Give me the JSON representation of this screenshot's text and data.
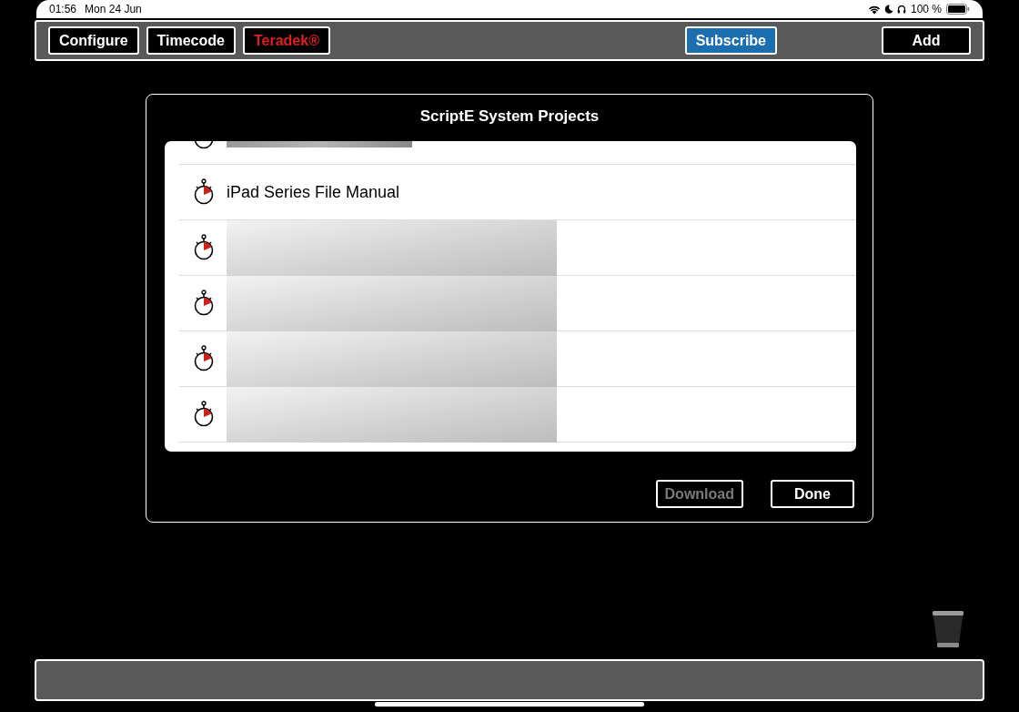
{
  "status_bar": {
    "time": "01:56",
    "date": "Mon 24 Jun",
    "battery": "100 %"
  },
  "toolbar": {
    "buttons": [
      {
        "label": "Configure",
        "kind": "plain"
      },
      {
        "label": "Timecode",
        "kind": "plain"
      },
      {
        "label": "Teradek®",
        "kind": "alert"
      },
      {
        "label": "Subscribe",
        "kind": "primary"
      },
      {
        "label": "Add",
        "kind": "wide"
      }
    ]
  },
  "dialog": {
    "title": "ScriptE System Projects",
    "rows": [
      {
        "kind": "redacted-partial"
      },
      {
        "kind": "text",
        "label": "iPad Series File Manual"
      },
      {
        "kind": "redacted"
      },
      {
        "kind": "redacted"
      },
      {
        "kind": "redacted"
      },
      {
        "kind": "redacted"
      }
    ],
    "buttons": [
      {
        "label": "Download",
        "disabled": true
      },
      {
        "label": "Done",
        "disabled": false
      }
    ]
  }
}
